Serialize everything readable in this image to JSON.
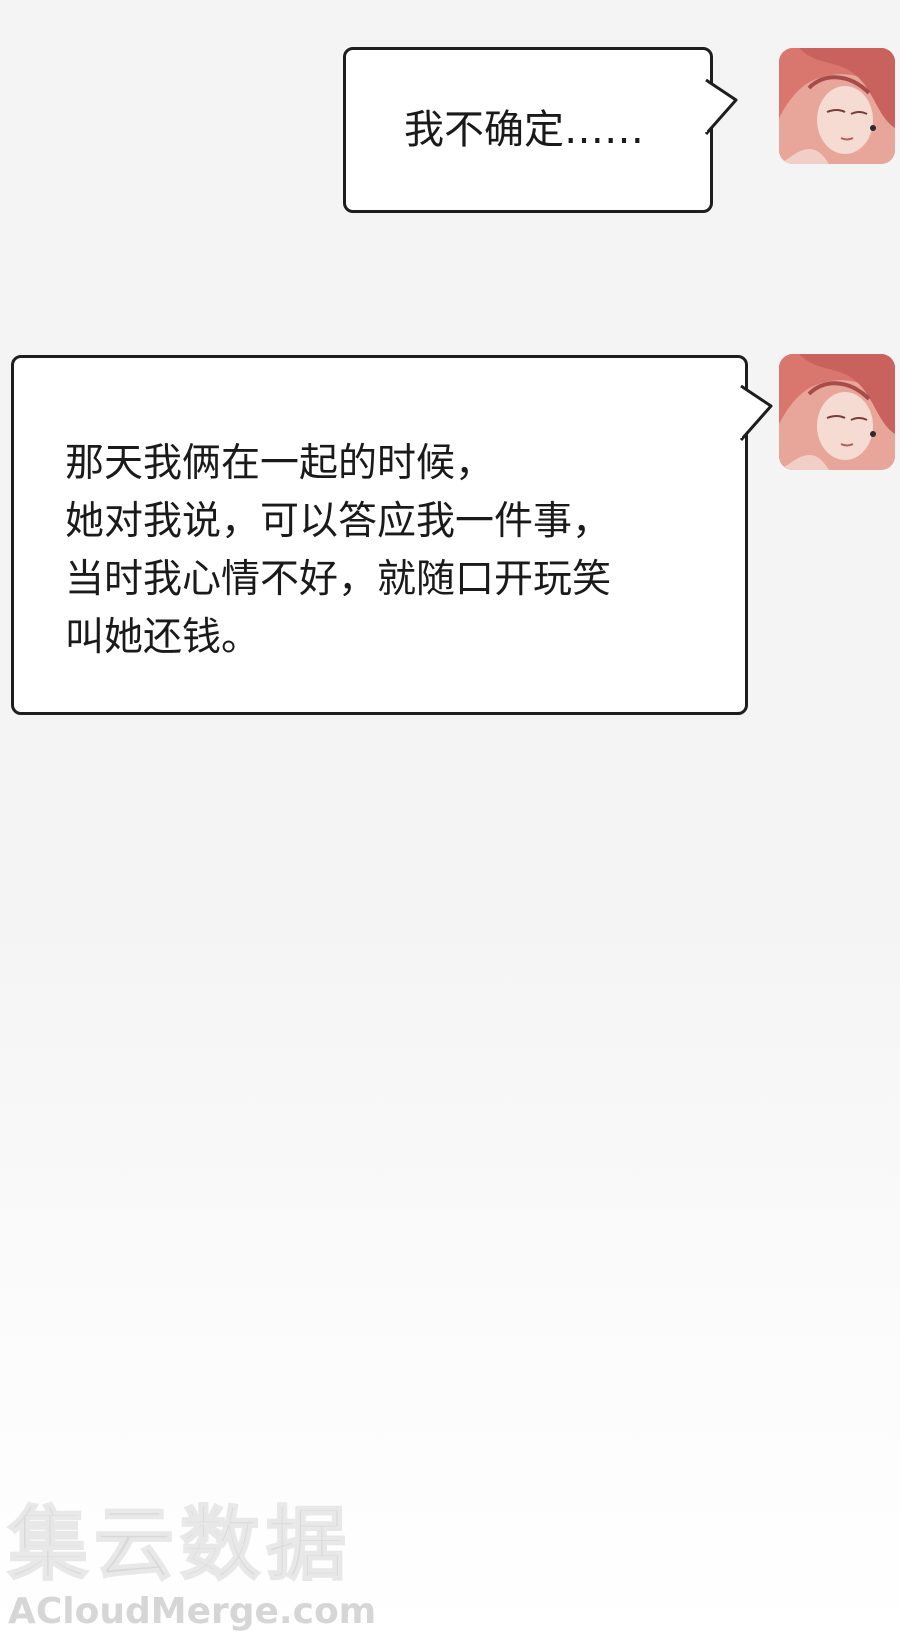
{
  "messages": [
    {
      "text": "我不确定……"
    },
    {
      "lines": [
        "那天我俩在一起的时候，",
        "她对我说，可以答应我一件事，",
        "当时我心情不好，就随口开玩笑",
        "叫她还钱。"
      ]
    }
  ],
  "avatar": {
    "icon": "avatar-portrait-icon",
    "hair_color": "#d9776f"
  },
  "watermark": {
    "cn": "集云数据",
    "en": "ACloudMerge.com"
  }
}
